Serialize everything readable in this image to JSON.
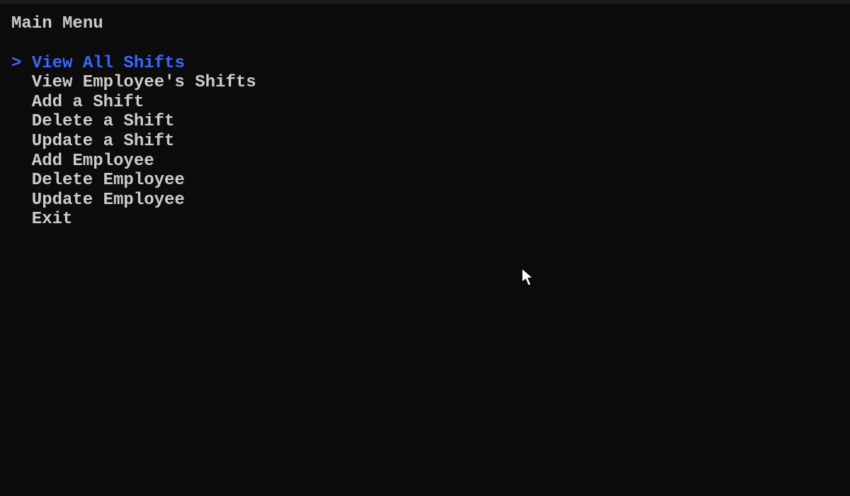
{
  "menu": {
    "title": "Main Menu",
    "selection_prefix": "> ",
    "items": [
      {
        "label": "View All Shifts",
        "selected": true
      },
      {
        "label": "View Employee's Shifts",
        "selected": false
      },
      {
        "label": "Add a Shift",
        "selected": false
      },
      {
        "label": "Delete a Shift",
        "selected": false
      },
      {
        "label": "Update a Shift",
        "selected": false
      },
      {
        "label": "Add Employee",
        "selected": false
      },
      {
        "label": "Delete Employee",
        "selected": false
      },
      {
        "label": "Update Employee",
        "selected": false
      },
      {
        "label": "Exit",
        "selected": false
      }
    ]
  },
  "colors": {
    "background": "#0c0c0c",
    "text": "#cccccc",
    "selected": "#3b66ff"
  }
}
